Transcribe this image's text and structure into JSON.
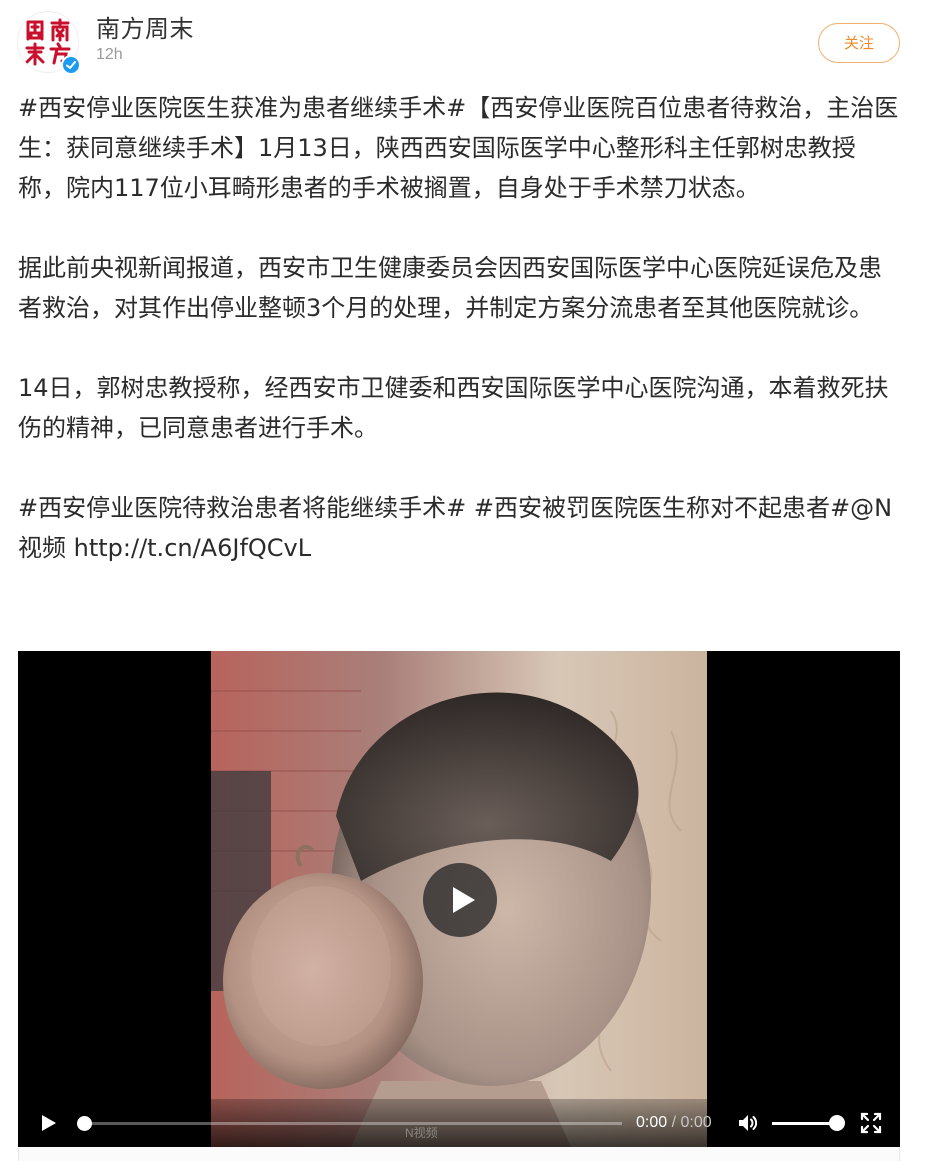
{
  "account": {
    "name": "南方周末",
    "time": "12h",
    "avatar_text": "周南末方",
    "verified_icon": "verified-badge-icon"
  },
  "actions": {
    "follow_label": "关注"
  },
  "post": {
    "paragraphs": [
      "#西安停业医院医生获准为患者继续手术#【西安停业医院百位患者待救治，主治医生：获同意继续手术】1月13日，陕西西安国际医学中心整形科主任郭树忠教授称，院内117位小耳畸形患者的手术被搁置，自身处于手术禁刀状态。",
      "据此前央视新闻报道，西安市卫生健康委员会因西安国际医学中心医院延误危及患者救治，对其作出停业整顿3个月的处理，并制定方案分流患者至其他医院就诊。",
      "14日，郭树忠教授称，经西安市卫健委和西安国际医学中心医院沟通，本着救死扶伤的精神，已同意患者进行手术。",
      "#西安停业医院待救治患者将能继续手术# #西安被罚医院医生称对不起患者#@N视频 http://t.cn/A6JfQCvL"
    ]
  },
  "video": {
    "current_time": "0:00",
    "separator": "/",
    "duration": "0:00",
    "progress": 0,
    "volume": 1.0,
    "watermark": "N视频"
  },
  "colors": {
    "follow_accent": "#ee8a2a",
    "verified": "#1d9bf0",
    "avatar_red": "#c8102e"
  }
}
